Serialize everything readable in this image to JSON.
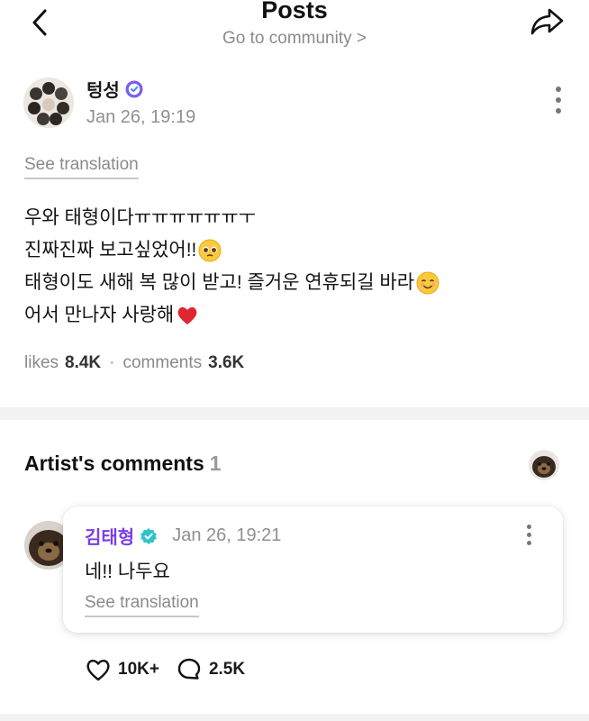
{
  "header": {
    "title": "Posts",
    "subtitle": "Go to community >",
    "back_icon": "chevron-left-icon",
    "share_icon": "share-arrow-icon"
  },
  "post": {
    "author": "텅성",
    "badge_icon": "verified-badge-icon",
    "time": "Jan 26, 19:19",
    "see_translation": "See translation",
    "lines": [
      "우와 태형이다ㅠㅠㅠㅠㅠㅠㅜ",
      "진짜진짜 보고싶었어!!",
      "태형이도 새해 복 많이 받고! 즐거운 연휴되길 바라",
      "어서 만나자 사랑해"
    ],
    "emojis": [
      "pleading-face-icon",
      "smiling-face-icon",
      "red-heart-icon"
    ],
    "likes_label": "likes",
    "likes_value": "8.4K",
    "separator": "·",
    "comments_label": "comments",
    "comments_value": "3.6K"
  },
  "artist_comments": {
    "title": "Artist's comments",
    "count": "1",
    "comment": {
      "author": "김태형",
      "time": "Jan 26, 19:21",
      "text": "네!! 나두요",
      "see_translation": "See translation",
      "likes": "10K+",
      "replies": "2.5K"
    }
  },
  "colors": {
    "artist_name": "#7b3fe4",
    "verified_badge": "#7b5cf5",
    "muted_text": "#8a8a8a"
  }
}
